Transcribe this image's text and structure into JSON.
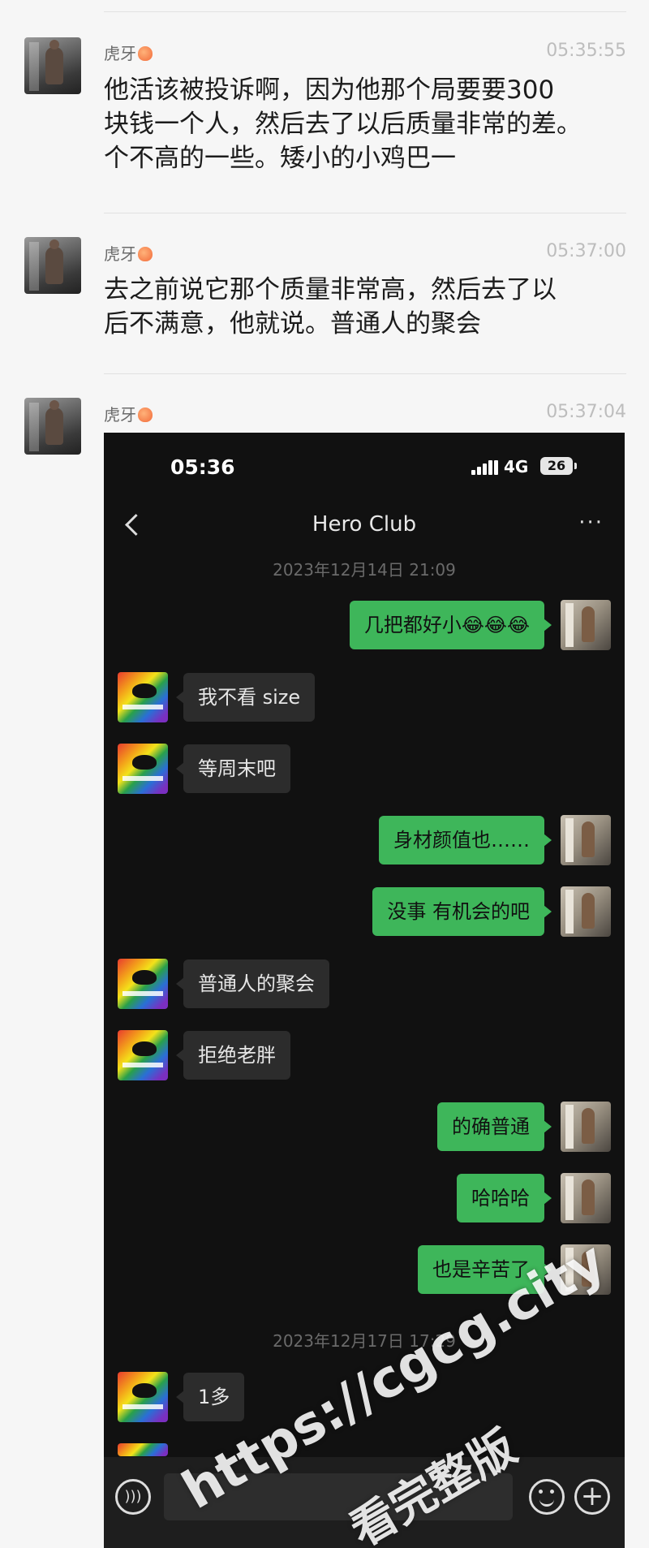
{
  "feed": {
    "messages": [
      {
        "sender": "虎牙",
        "time": "05:35:55",
        "lines": [
          "他活该被投诉啊，因为他那个局要要300",
          "块钱一个人，然后去了以后质量非常的差。",
          "个不高的一些。矮小的小鸡巴一"
        ]
      },
      {
        "sender": "虎牙",
        "time": "05:37:00",
        "lines": [
          "去之前说它那个质量非常高，然后去了以",
          "后不满意，他就说。普通人的聚会"
        ]
      },
      {
        "sender": "虎牙",
        "time": "05:37:04"
      }
    ]
  },
  "phone": {
    "status_time": "05:36",
    "network": "4G",
    "battery": "26",
    "title": "Hero Club",
    "more": "···",
    "date1": "2023年12月14日 21:09",
    "date2": "2023年12月17日 17:29",
    "chat": [
      {
        "dir": "out",
        "text": "几把都好小😂😂😂"
      },
      {
        "dir": "in",
        "text": "我不看 size"
      },
      {
        "dir": "in",
        "text": "等周末吧"
      },
      {
        "dir": "out",
        "text": "身材颜值也……"
      },
      {
        "dir": "out",
        "text": "没事 有机会的吧"
      },
      {
        "dir": "in",
        "text": "普通人的聚会"
      },
      {
        "dir": "in",
        "text": "拒绝老胖"
      },
      {
        "dir": "out",
        "text": "的确普通"
      },
      {
        "dir": "out",
        "text": "哈哈哈"
      },
      {
        "dir": "out",
        "text": "也是辛苦了"
      },
      {
        "dir": "in",
        "text": "1多"
      }
    ],
    "input_placeholder": ""
  },
  "watermark": {
    "url": "https://cgcg.city",
    "caption": "看完整版"
  },
  "colors": {
    "out_bubble": "#3eb65a",
    "in_bubble": "#2c2c2c",
    "phone_bg": "#111111",
    "feed_bg": "#f6f6f6"
  }
}
